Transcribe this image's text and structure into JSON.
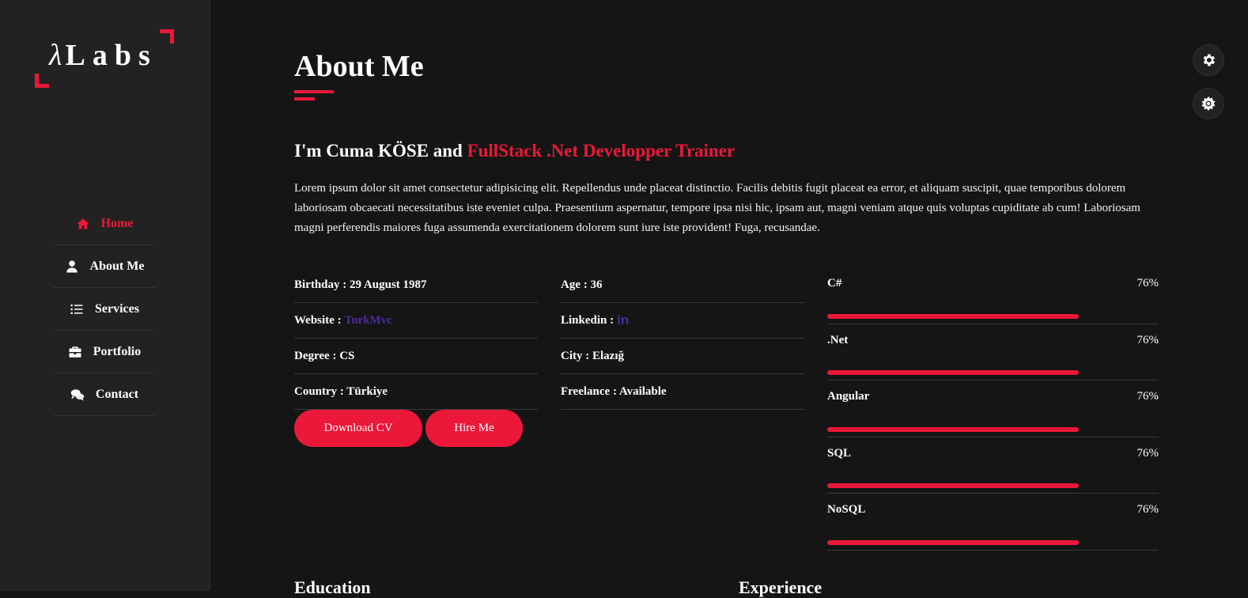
{
  "brand": {
    "lambda": "λ",
    "name": "Labs"
  },
  "nav": [
    {
      "label": "Home",
      "icon": "home-icon",
      "active": true
    },
    {
      "label": "About Me",
      "icon": "user-icon"
    },
    {
      "label": "Services",
      "icon": "list-icon"
    },
    {
      "label": "Portfolio",
      "icon": "briefcase-icon"
    },
    {
      "label": "Contact",
      "icon": "comments-icon"
    }
  ],
  "page": {
    "title": "About Me",
    "intro_prefix": "I'm Cuma KÖSE and ",
    "intro_accent": "FullStack .Net Developper Trainer",
    "description": "Lorem ipsum dolor sit amet consectetur adipisicing elit. Repellendus unde placeat distinctio. Facilis debitis fugit placeat ea error, et aliquam suscipit, quae temporibus dolorem laboriosam obcaecati necessitatibus iste eveniet culpa. Praesentium aspernatur, tempore ipsa nisi hic, ipsam aut, magni veniam atque quis voluptas cupiditate ab cum! Laboriosam magni perferendis maiores fuga assumenda exercitationem dolorem sunt iure iste provident! Fuga, recusandae."
  },
  "info_left": {
    "birthday": "Birthday : 29 August 1987",
    "website_label": "Website :",
    "website_link": "TurkMvc",
    "degree": "Degree : CS",
    "country": "Country : Türkiye"
  },
  "info_right": {
    "age": "Age : 36",
    "linkedin_label": "Linkedin :",
    "linkedin_link": "in",
    "city": "City : Elazığ",
    "freelance": "Freelance : Available"
  },
  "buttons": {
    "cv": "Download CV",
    "hire": "Hire Me"
  },
  "skills": {
    "items": [
      {
        "name": "C#",
        "percent": "76%",
        "level": 0.76
      },
      {
        "name": ".Net",
        "percent": "76%",
        "level": 0.76
      },
      {
        "name": "Angular",
        "percent": "76%",
        "level": 0.76
      },
      {
        "name": "SQL",
        "percent": "76%",
        "level": 0.76
      },
      {
        "name": "NoSQL",
        "percent": "76%",
        "level": 0.76
      }
    ]
  },
  "sections": {
    "education": "Education",
    "experience": "Experience"
  },
  "colors": {
    "accent": "#ec1839",
    "link": "#4b2a9e",
    "background": "#151515",
    "sidebar": "#222222"
  },
  "floating": {
    "settings": "gear-icon",
    "theme": "sun-icon"
  }
}
